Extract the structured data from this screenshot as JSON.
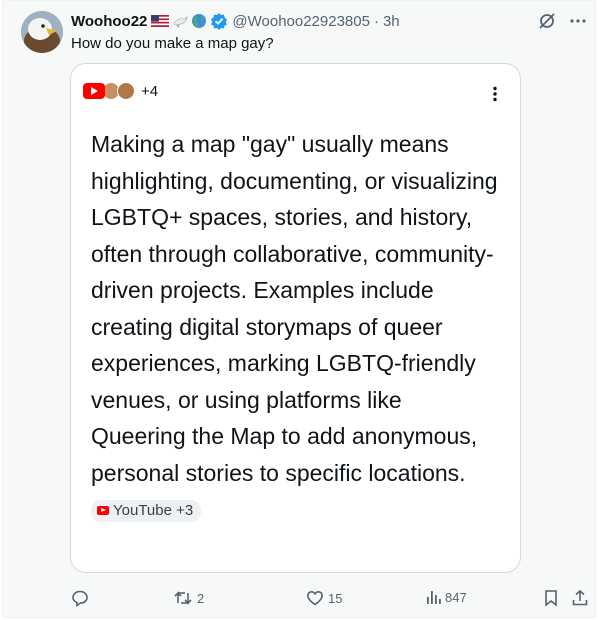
{
  "post": {
    "display_name": "Woohoo22",
    "handle": "@Woohoo22923805",
    "separator": "·",
    "time": "3h",
    "text": "How do you make a map gay?"
  },
  "card": {
    "sources_more": "+4",
    "answer": "Making a map \"gay\" usually means highlighting, documenting, or visualizing LGBTQ+ spaces, stories, and history, often through collaborative, community-driven projects. Examples include creating digital storymaps of queer experiences, marking LGBTQ-friendly venues, or using platforms like Queering the Map to add anonymous, personal stories to specific locations.",
    "chip_label": "YouTube +3"
  },
  "actions": {
    "reposts": "2",
    "likes": "15",
    "views": "847"
  },
  "icons": [
    "avatar-eagle",
    "us-flag-icon",
    "dove-icon",
    "earth-icon",
    "verified-icon",
    "grok-icon",
    "more-icon",
    "youtube-icon",
    "reply-icon",
    "repost-icon",
    "like-icon",
    "views-icon",
    "bookmark-icon",
    "share-icon"
  ],
  "colors": {
    "verified": "#1d9bf0",
    "youtube": "#ff0000",
    "muted": "#536471"
  }
}
